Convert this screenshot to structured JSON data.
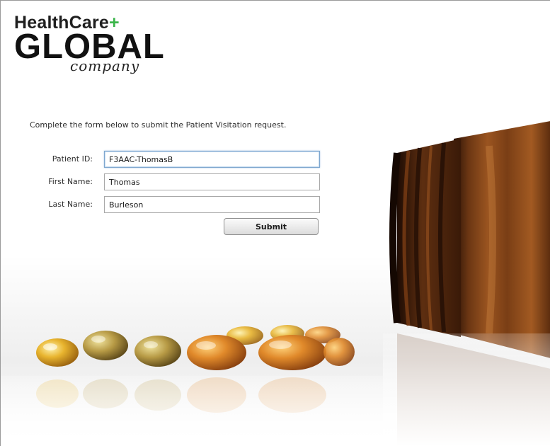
{
  "logo": {
    "line1": "HealthCare",
    "plus": "+",
    "line2": "GLOBAL",
    "line3": "company"
  },
  "form": {
    "instructions": "Complete the form below to submit the Patient Visitation request.",
    "fields": [
      {
        "label": "Patient ID:",
        "value": "F3AAC-ThomasB"
      },
      {
        "label": "First Name:",
        "value": "Thomas"
      },
      {
        "label": "Last Name:",
        "value": "Burleson"
      }
    ],
    "submit_label": "Submit"
  },
  "colors": {
    "plus_green": "#3bb54a",
    "focus_border": "#7fa7cf",
    "bottle_amber": "#5a2e10",
    "capsule_gold": "#e0a52a"
  },
  "icons": {
    "background_image": "pill-bottle-with-capsules-photo"
  }
}
